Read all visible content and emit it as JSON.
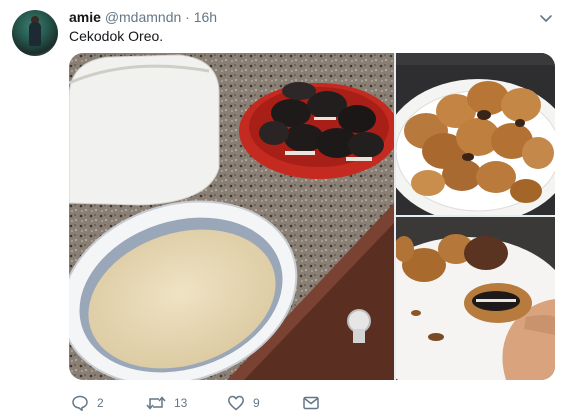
{
  "tweet": {
    "display_name": "amie",
    "handle": "@mdamndn",
    "separator": "·",
    "time": "16h",
    "text": "Cekodok Oreo."
  },
  "media": {
    "photos": [
      "batter bowl and oreos on countertop",
      "plate of fried fritters",
      "fried oreo fritter held in hand"
    ]
  },
  "actions": {
    "reply_count": "2",
    "retweet_count": "13",
    "like_count": "9"
  },
  "icons": {
    "reply": "comment-icon",
    "retweet": "retweet-icon",
    "like": "heart-icon",
    "dm": "envelope-icon",
    "menu": "chevron-down-icon"
  },
  "colors": {
    "icon_gray": "#657786",
    "text": "#14171a",
    "background": "#ffffff"
  }
}
